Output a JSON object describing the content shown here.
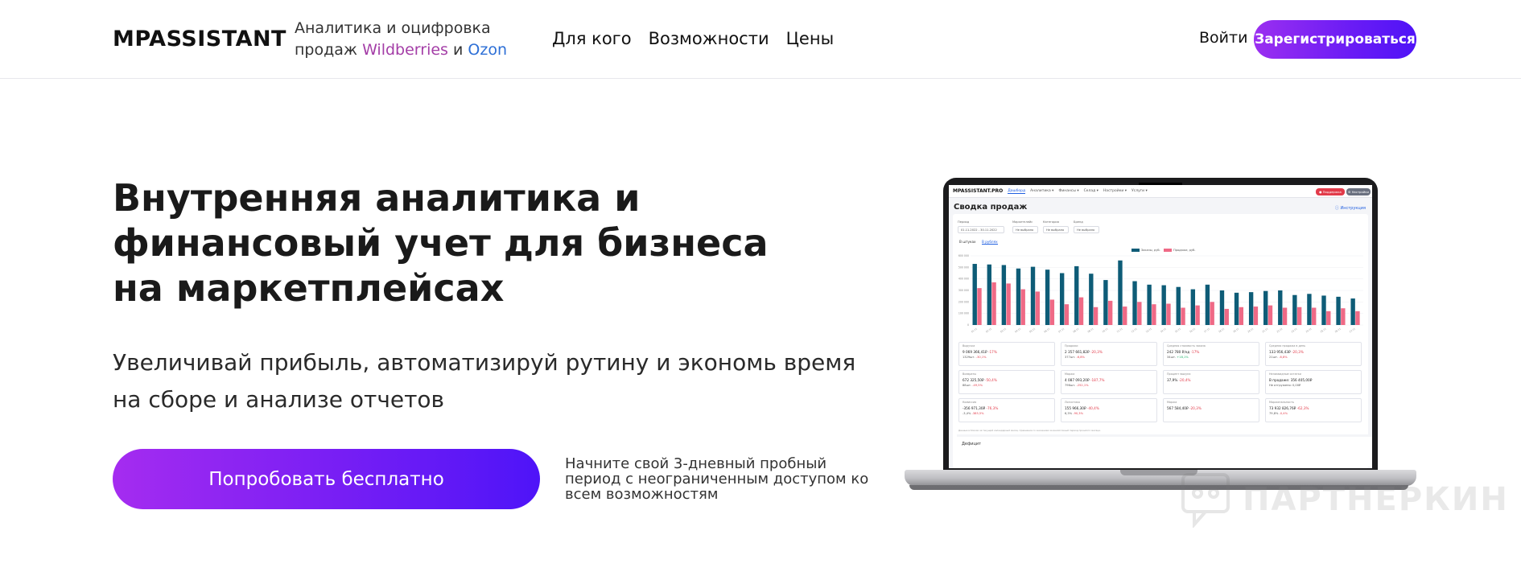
{
  "header": {
    "logo": "MPASSISTANT",
    "tagline_prefix": "Аналитика и оцифровка",
    "tagline_line2_start": "продаж",
    "tagline_wb": "Wildberries",
    "tagline_and": "и",
    "tagline_ozon": "Ozon",
    "nav": [
      "Для кого",
      "Возможности",
      "Цены"
    ],
    "login": "Войти",
    "signup": "Зарегистрироваться",
    "brand_gradient": [
      "#9b2ff0",
      "#4f13f7"
    ]
  },
  "hero": {
    "title": "Внутренняя аналитика и финансовый учет для бизнеса на маркетплейсах",
    "subtitle": "Увеличивай прибыль, автоматизируй рутину и экономь время на сборе и анализе отчетов",
    "cta": "Попробовать бесплатно",
    "trial_note": "Начните свой 3-дневный пробный период с неограниченным доступом ко всем возможностям"
  },
  "mockup": {
    "app_logo": "MPASSISTANT.PRO",
    "menu": [
      "Дашборд",
      "Аналитика ▾",
      "Финансы ▾",
      "Склад ▾",
      "Настройки ▾",
      "Услуги ▾"
    ],
    "btn_support": "● Поддержка",
    "btn_settings": "⚙ Настройки",
    "page_title": "Сводка продаж",
    "help": "Инструкция",
    "filters": [
      {
        "label": "Период",
        "value": "01.11.2022 - 30.11.2022"
      },
      {
        "label": "Маркетплейс",
        "value": "Не выбрано"
      },
      {
        "label": "Категория",
        "value": "Не выбрано"
      },
      {
        "label": "Бренд",
        "value": "Не выбрано"
      }
    ],
    "tabs": [
      "В штуках",
      "В рублях"
    ],
    "legend": [
      {
        "name": "Заказы, руб.",
        "color": "#0e5c77"
      },
      {
        "name": "Продажи, руб.",
        "color": "#ef6a86"
      }
    ],
    "cards": [
      {
        "label": "Выручка",
        "v1": "9 069 366,41₽",
        "d1": "-17%",
        "v2": "1329шт.",
        "d2": "-30,1%"
      },
      {
        "label": "Продажи",
        "v1": "2 357 661,82₽",
        "d1": "-20,3%",
        "v2": "377шт.",
        "d2": "-6,8%"
      },
      {
        "label": "Средняя стоимость заказа",
        "v1": "242 780 ₽/ед",
        "d1": "-17%",
        "v2": "34шт.",
        "d2": "+18,1%"
      },
      {
        "label": "Средняя продажа в день",
        "v1": "133 956,43₽",
        "d1": "-20,3%",
        "v2": "21шт.",
        "d2": "-6,8%"
      },
      {
        "label": "Возвраты",
        "v1": "672 325,50₽",
        "d1": "-50,4%",
        "v2": "88шт.",
        "d2": "-49,5%"
      },
      {
        "label": "Маржа",
        "v1": "4 087 093,20₽",
        "d1": "-187,7%",
        "v2": "796шт.",
        "d2": "-252,1%"
      },
      {
        "label": "Процент выкупа",
        "v1": "37,9%",
        "d1": "-20,4%",
        "v2": "",
        "d2": ""
      },
      {
        "label": "Неликвидные остатки",
        "v1": "В продаже: 356 405,00₽",
        "d1": "",
        "v2": "Не отгружено: 0,00₽",
        "d2": ""
      },
      {
        "label": "Комиссия",
        "v1": "-356 971,30₽",
        "d1": "-76,3%",
        "v2": "-3,4%",
        "d2": "-385,5%"
      },
      {
        "label": "Логистика",
        "v1": "155 966,30₽",
        "d1": "-40,4%",
        "v2": "6,3%",
        "d2": "-90,3%"
      },
      {
        "label": "Маржа",
        "v1": "567 584,40₽",
        "d1": "-20,3%",
        "v2": "",
        "d2": ""
      },
      {
        "label": "Маржинальность",
        "v1": "73 932 826,76₽",
        "d1": "-62,3%",
        "v2": "79,8%",
        "d2": "-0,4%"
      }
    ],
    "note": "Данные в блоках за текущий календарный месяц. Сравнение со значением за аналогичный период прошлого месяца.",
    "footer_section": "Дефицит"
  },
  "chart_data": {
    "type": "bar",
    "title": "",
    "categories": [
      "01.11",
      "02.11",
      "03.11",
      "04.11",
      "05.11",
      "06.11",
      "07.11",
      "08.11",
      "09.11",
      "10.11",
      "11.11",
      "12.11",
      "13.11",
      "14.11",
      "15.11",
      "16.11",
      "17.11",
      "18.11",
      "19.11",
      "20.11",
      "21.11",
      "22.11",
      "23.11",
      "24.11",
      "25.11",
      "26.11",
      "27.11"
    ],
    "series": [
      {
        "name": "Заказы, руб.",
        "values": [
          530,
          525,
          520,
          490,
          505,
          480,
          450,
          510,
          445,
          390,
          560,
          380,
          350,
          345,
          330,
          310,
          350,
          300,
          280,
          285,
          295,
          300,
          260,
          270,
          255,
          245,
          230
        ]
      },
      {
        "name": "Продажи, руб.",
        "values": [
          320,
          370,
          360,
          310,
          290,
          220,
          180,
          240,
          155,
          210,
          160,
          200,
          180,
          185,
          150,
          170,
          200,
          140,
          155,
          160,
          170,
          150,
          155,
          150,
          120,
          145,
          120
        ]
      }
    ],
    "y_ticks": [
      "600 000",
      "500 000",
      "400 000",
      "300 000",
      "200 000",
      "100 000",
      "0"
    ],
    "ylim": [
      0,
      600
    ],
    "colors": [
      "#0e5c77",
      "#ef6a86"
    ]
  },
  "watermark": "ПАРТНЕРКИН"
}
